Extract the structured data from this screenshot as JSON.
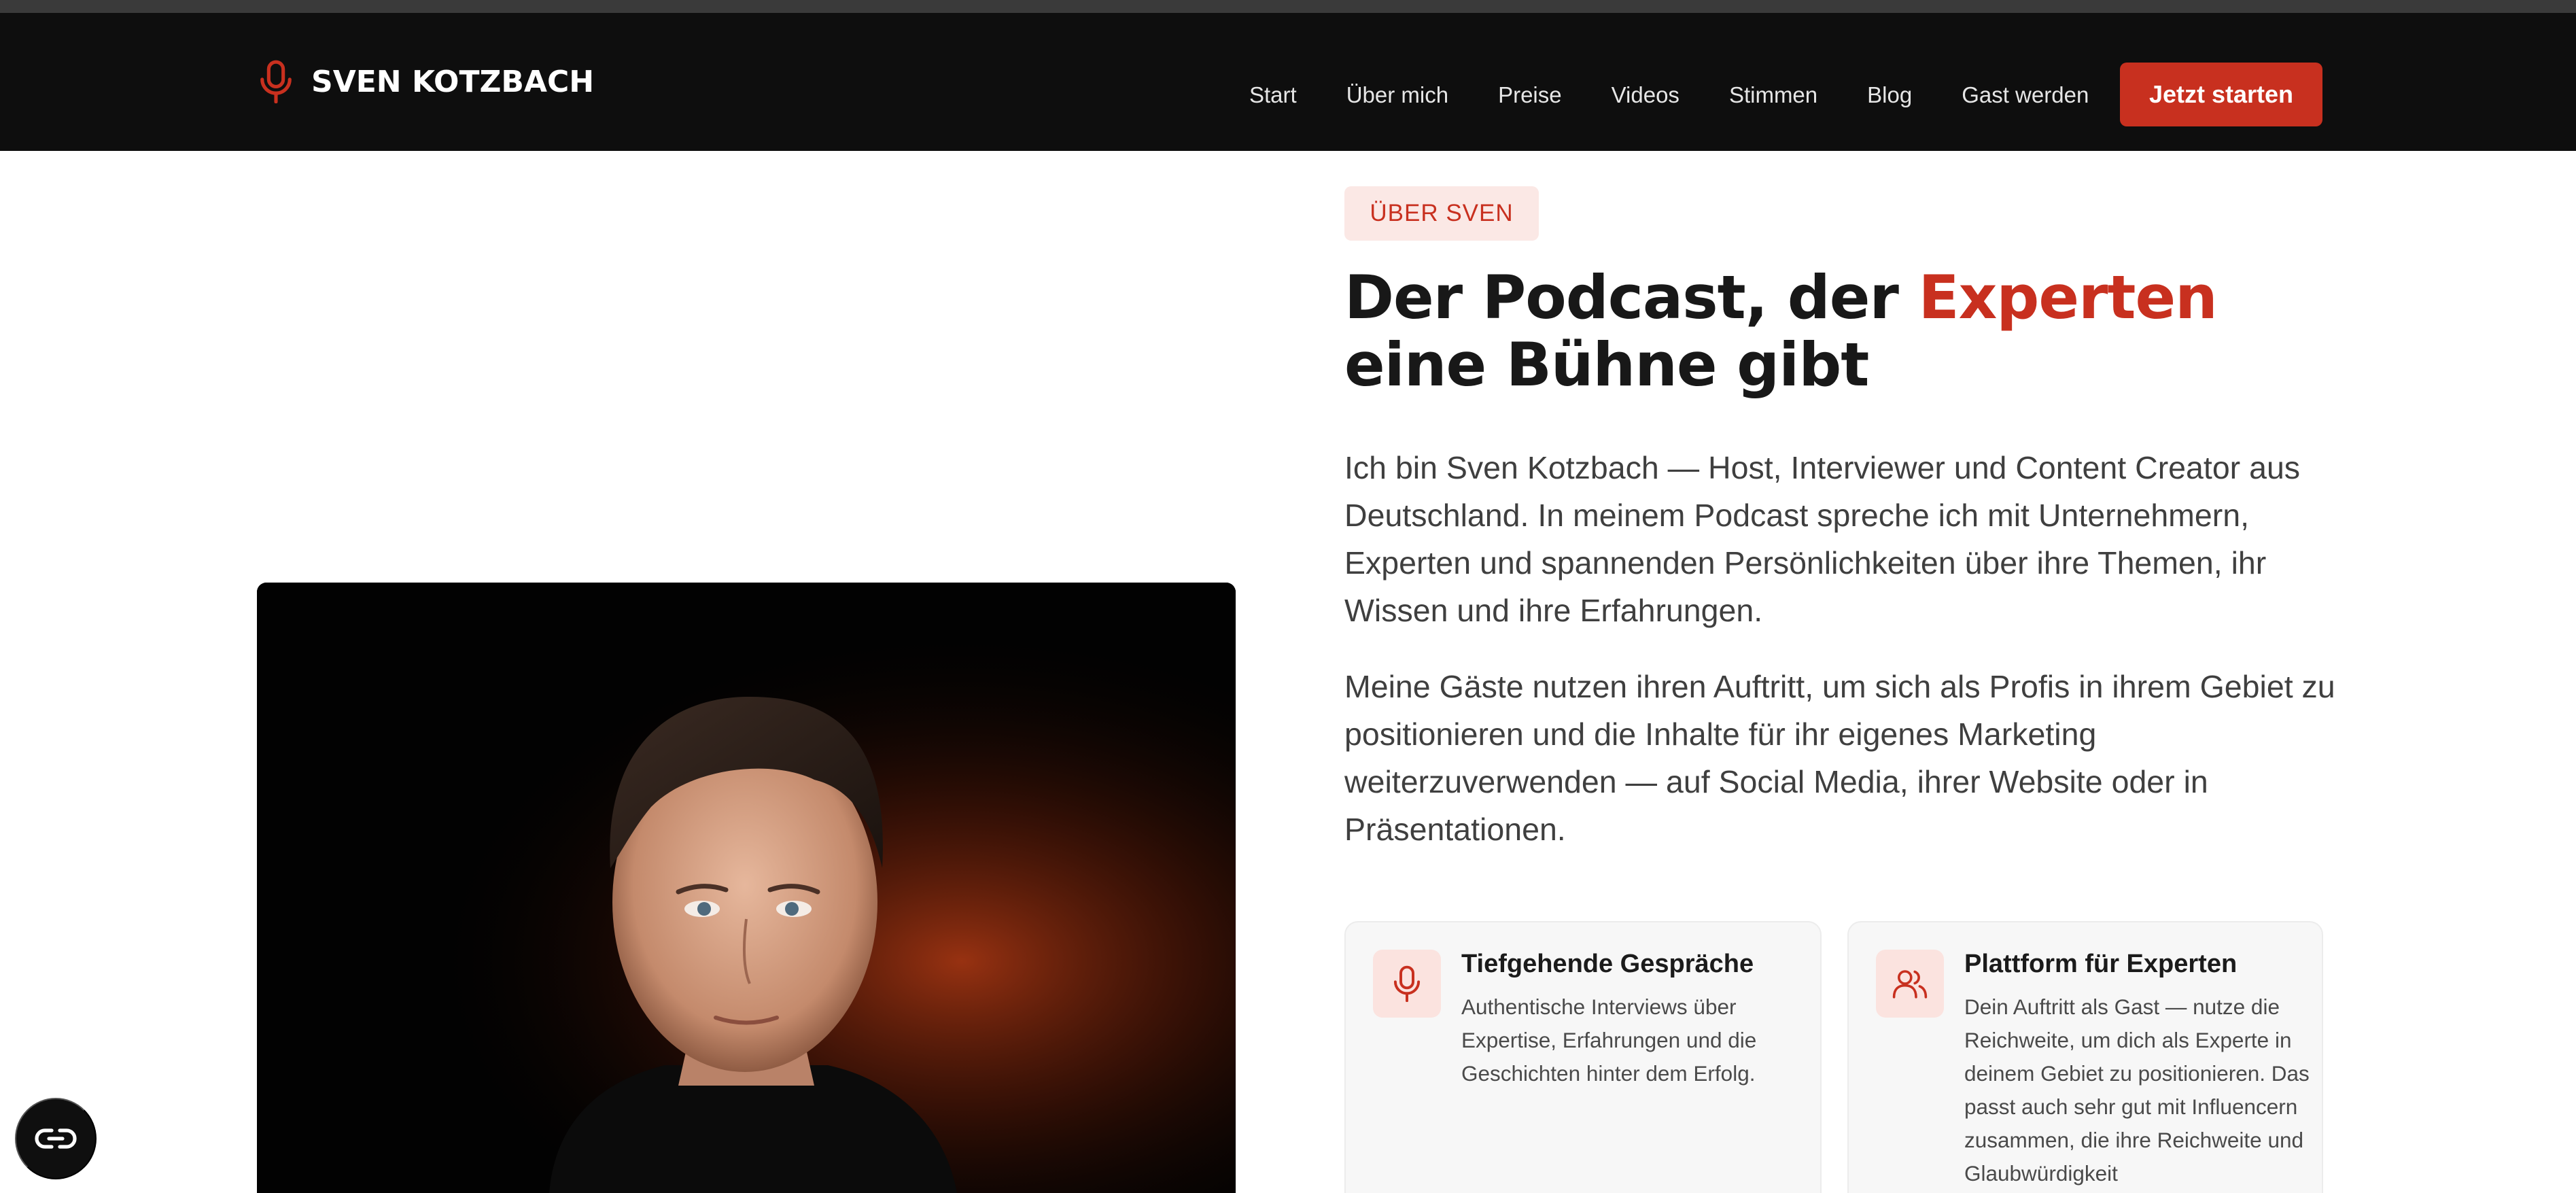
{
  "brand": {
    "name": "SVEN KOTZBACH",
    "icon": "microphone-icon",
    "accent_color": "#c8301f"
  },
  "nav": {
    "links": [
      "Start",
      "Über mich",
      "Preise",
      "Videos",
      "Stimmen",
      "Blog",
      "Gast werden"
    ],
    "cta_label": "Jetzt starten"
  },
  "hero": {
    "eyebrow": "ÜBER SVEN",
    "headline_before": "Der Podcast, der ",
    "headline_accent": "Experten",
    "headline_after": " eine Bühne gibt",
    "paragraph_1": "Ich bin Sven Kotzbach — Host, Interviewer und Content Creator aus Deutschland. In meinem Podcast spreche ich mit Unternehmern, Experten und spannenden Persönlichkeiten über ihre Themen, ihr Wissen und ihre Erfahrungen.",
    "paragraph_2": "Meine Gäste nutzen ihren Auftritt, um sich als Profis in ihrem Gebiet zu positionieren und die Inhalte für ihr eigenes Marketing weiterzuverwenden — auf Social Media, ihrer Website oder in Präsentationen."
  },
  "photo": {
    "subject": "portrait-photo",
    "background_color": "#020202",
    "glow_color": "#b23a14"
  },
  "features": [
    {
      "icon": "microphone-icon",
      "title": "Tiefgehende Gespräche",
      "text": "Authentische Interviews über Expertise, Erfahrungen und die Geschichten hinter dem Erfolg."
    },
    {
      "icon": "users-icon",
      "title": "Plattform für Experten",
      "text": "Dein Auftritt als Gast — nutze die Reichweite, um dich als Experte in deinem Gebiet zu positionieren. Das passt auch sehr gut mit Influencern zusammen, die ihre Reichweite und Glaubwürdigkeit"
    }
  ],
  "widget": {
    "icon": "accessibility-link-icon"
  }
}
